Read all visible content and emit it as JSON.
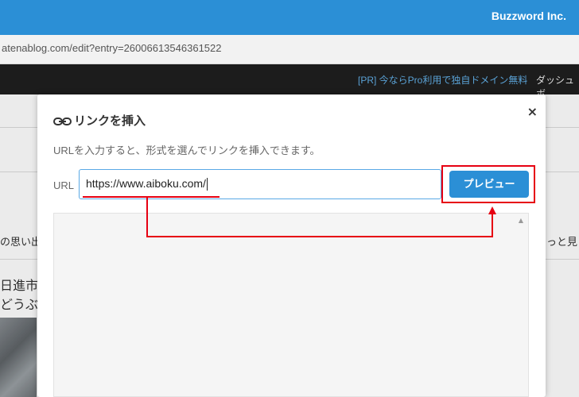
{
  "brand": {
    "name": "Buzzword Inc."
  },
  "address_bar": {
    "url": "atenablog.com/edit?entry=26006613546361522"
  },
  "header": {
    "promo": "[PR] 今ならPro利用で独自ドメイン無料",
    "dashboard": "ダッシュボ"
  },
  "background": {
    "left_text_1": "の思い出",
    "right_text_1": "ちっと見",
    "big_text_1": "日進市",
    "big_text_2": "どうぶ"
  },
  "modal": {
    "title": "リンクを挿入",
    "close": "×",
    "description": "URLを入力すると、形式を選んでリンクを挿入できます。",
    "url_label": "URL",
    "url_value": "https://www.aiboku.com/",
    "preview_button": "プレビュー",
    "scroll_up": "▲"
  },
  "colors": {
    "accent": "#2b8fd6",
    "annotation": "#e60012",
    "header_dark": "#1c1c1c"
  },
  "icons": {
    "link": "link-icon",
    "close": "close-icon"
  }
}
